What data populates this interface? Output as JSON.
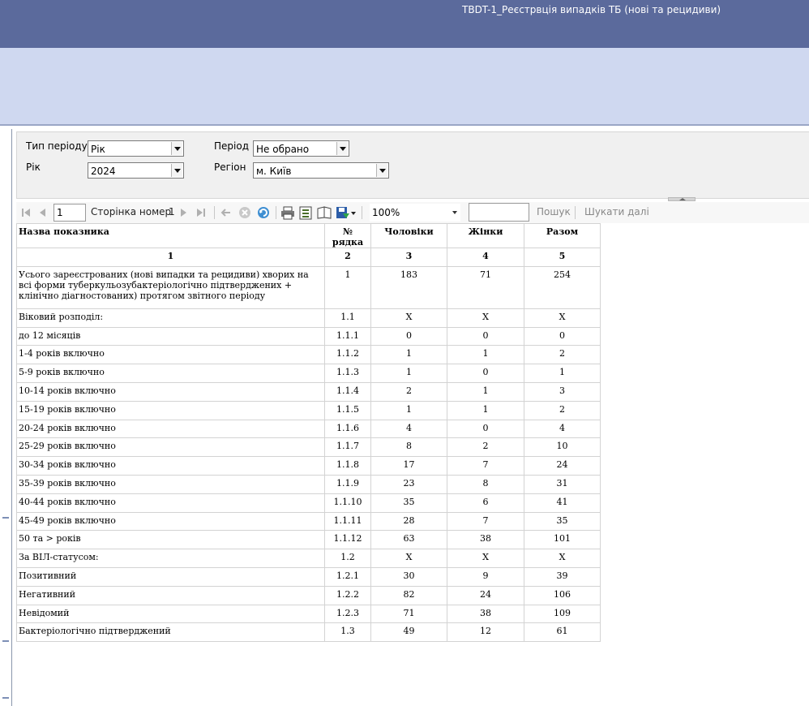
{
  "app": {
    "title": "TBDT-1_Реєстрвція випадків ТБ (нові та рецидиви)"
  },
  "params": {
    "period_type_label": "Тип періоду",
    "period_type_value": "Рік",
    "year_label": "Рік",
    "year_value": "2024",
    "period_label": "Період",
    "period_value": "Не обрано",
    "region_label": "Регіон",
    "region_value": "м. Київ"
  },
  "toolbar": {
    "page_value": "1",
    "page_label": "Сторінка номер",
    "page_count": "1",
    "zoom_value": "100%",
    "search_label": "Пошук",
    "find_next_label": "Шукати далі"
  },
  "table": {
    "headers": [
      "Назва показника",
      "№ рядка",
      "Чоловіки",
      "Жінки",
      "Разом"
    ],
    "col_numbers": [
      "1",
      "2",
      "3",
      "4",
      "5"
    ],
    "rows": [
      [
        "Усього зареєстрованих (нові випадки та рецидиви) хворих на всі форми туберкульозубактеріологічно підтверджених + клінічно діагностованих) протягом звітного періоду",
        "1",
        "183",
        "71",
        "254"
      ],
      [
        "Віковий розподіл:",
        "1.1",
        "X",
        "X",
        "X"
      ],
      [
        "до 12 місяців",
        "1.1.1",
        "0",
        "0",
        "0"
      ],
      [
        "1-4 років включно",
        "1.1.2",
        "1",
        "1",
        "2"
      ],
      [
        "5-9 років включно",
        "1.1.3",
        "1",
        "0",
        "1"
      ],
      [
        "10-14 років включно",
        "1.1.4",
        "2",
        "1",
        "3"
      ],
      [
        "15-19 років включно",
        "1.1.5",
        "1",
        "1",
        "2"
      ],
      [
        "20-24 років включно",
        "1.1.6",
        "4",
        "0",
        "4"
      ],
      [
        "25-29 років включно",
        "1.1.7",
        "8",
        "2",
        "10"
      ],
      [
        "30-34 років включно",
        "1.1.8",
        "17",
        "7",
        "24"
      ],
      [
        "35-39 років включно",
        "1.1.9",
        "23",
        "8",
        "31"
      ],
      [
        "40-44 років включно",
        "1.1.10",
        "35",
        "6",
        "41"
      ],
      [
        "45-49 років включно",
        "1.1.11",
        "28",
        "7",
        "35"
      ],
      [
        "50 та > років",
        "1.1.12",
        "63",
        "38",
        "101"
      ],
      [
        "За ВІЛ-статусом:",
        "1.2",
        "X",
        "X",
        "X"
      ],
      [
        "Позитивний",
        "1.2.1",
        "30",
        "9",
        "39"
      ],
      [
        "Негативний",
        "1.2.2",
        "82",
        "24",
        "106"
      ],
      [
        "Невідомий",
        "1.2.3",
        "71",
        "38",
        "109"
      ],
      [
        "Бактеріологічно підтверджений",
        "1.3",
        "49",
        "12",
        "61"
      ]
    ]
  }
}
